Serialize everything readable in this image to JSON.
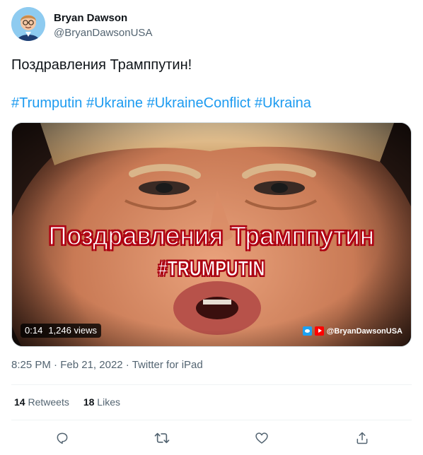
{
  "author": {
    "name": "Bryan Dawson",
    "handle": "@BryanDawsonUSA"
  },
  "tweet": {
    "text": "Поздравления Трамппутин!",
    "hashtags": [
      "#Trumputin",
      "#Ukraine",
      "#UkraineConflict",
      "#Ukraina"
    ]
  },
  "media": {
    "overlay_title": "Поздравления Трамппутин",
    "overlay_hashtag": "#TRUMPUTIN",
    "duration": "0:14",
    "views": "1,246 views",
    "watermark": "@BryanDawsonUSA"
  },
  "meta": {
    "time": "8:25 PM",
    "separator": "·",
    "date": "Feb 21, 2022",
    "source": "Twitter for iPad"
  },
  "stats": {
    "retweets_count": "14",
    "retweets_label": "Retweets",
    "likes_count": "18",
    "likes_label": "Likes"
  },
  "icons": {
    "reply": "reply-icon",
    "retweet": "retweet-icon",
    "like": "heart-icon",
    "share": "share-icon"
  },
  "colors": {
    "accent": "#1d9bf0",
    "secondary_text": "#536471",
    "primary_text": "#0f1419",
    "overlay_red": "#c8001a"
  }
}
